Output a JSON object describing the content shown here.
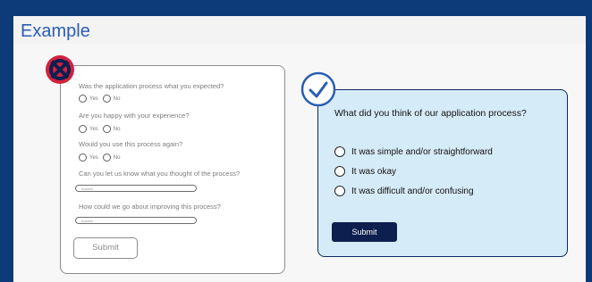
{
  "heading": "Example",
  "bad_form": {
    "questions": [
      {
        "text": "Was the application process what you expected?",
        "options": [
          "Yes",
          "No"
        ]
      },
      {
        "text": "Are you happy with your experience?",
        "options": [
          "Yes",
          "No"
        ]
      },
      {
        "text": "Would you use this process again?",
        "options": [
          "Yes",
          "No"
        ]
      }
    ],
    "text_questions": [
      {
        "text": "Can you let us know what you thought of the process?",
        "placeholder": "Answer"
      },
      {
        "text": "How could we go about improving this process?",
        "placeholder": "Answer"
      }
    ],
    "submit_label": "Submit",
    "badge_icon": "no-entry-icon",
    "badge_color": "#d1223f"
  },
  "good_form": {
    "question": "What did you think of our application process?",
    "options": [
      "It was simple and/or straightforward",
      "It was okay",
      "It was difficult and/or confusing"
    ],
    "submit_label": "Submit",
    "badge_icon": "checkmark-icon",
    "accent": "#2a5db5",
    "panel_color": "#d6ebf8"
  }
}
